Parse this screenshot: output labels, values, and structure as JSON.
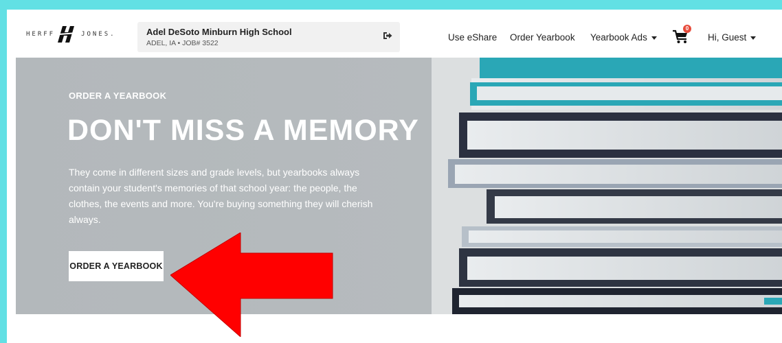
{
  "brand": {
    "logo_left": "HERFF",
    "logo_right": "JONES."
  },
  "school": {
    "name": "Adel DeSoto Minburn High School",
    "location": "ADEL, IA • JOB# 3522",
    "signout_icon": "sign-out-icon"
  },
  "nav": {
    "items": [
      {
        "label": "Use eShare"
      },
      {
        "label": "Order Yearbook"
      },
      {
        "label": "Yearbook Ads"
      }
    ],
    "cart_count": "0",
    "cart_icon": "cart-icon",
    "user_label": "Hi, Guest"
  },
  "hero": {
    "eyebrow": "ORDER A YEARBOOK",
    "title": "DON'T MISS A MEMORY",
    "body": "They come in different sizes and grade levels, but yearbooks always contain your student's memories of that school year: the people, the clothes, the events and more. You're buying something they will cherish always.",
    "button_label": "ORDER A YEARBOOK"
  },
  "colors": {
    "page_border": "#62e0e4",
    "hero_bg": "#b6bbbe",
    "arrow": "#ff0000",
    "badge": "#e74c3c",
    "book_accent": "#2aa7b6"
  }
}
